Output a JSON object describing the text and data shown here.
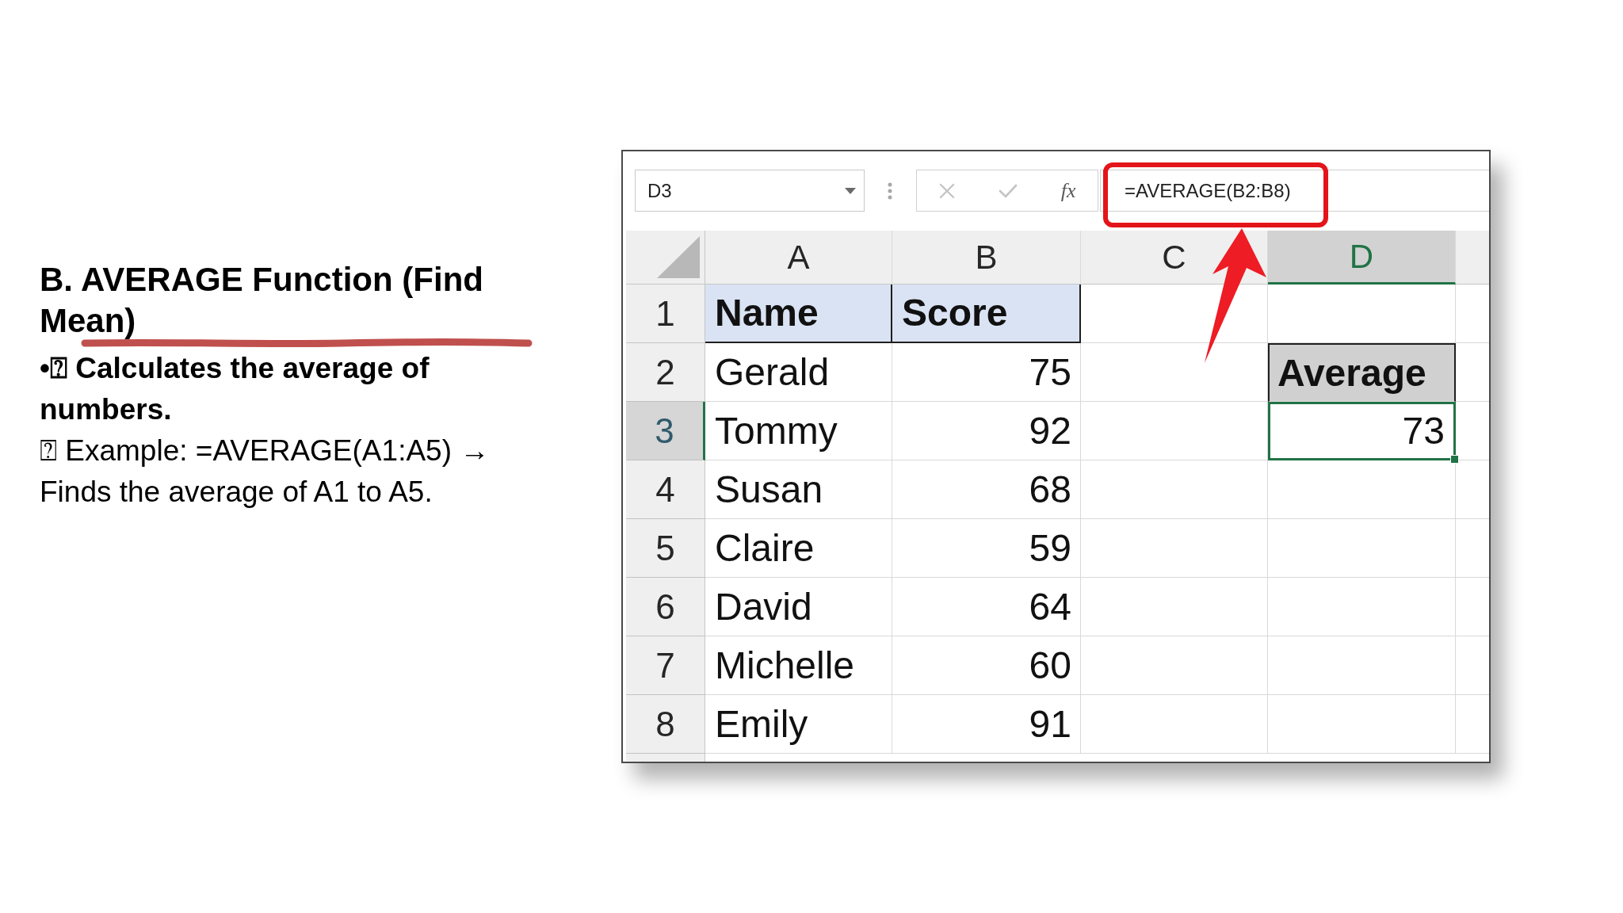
{
  "slide": {
    "title": {
      "text": "B. AVERAGE Function (Find Mean)",
      "underlined": true
    },
    "points": [
      {
        "kind": "bullet",
        "text": "•⍰ Calculates the average of numbers."
      },
      {
        "kind": "example",
        "text": "⍰ Example: =AVERAGE(A1:A5) → Finds the average of A1 to A5."
      }
    ]
  },
  "spreadsheet": {
    "name_box": {
      "value": "D3"
    },
    "formula_buttons": [
      {
        "kind": "cancel",
        "disabled": true
      },
      {
        "kind": "enter",
        "disabled": true
      },
      {
        "kind": "function",
        "label": "fx",
        "disabled": false
      }
    ],
    "formula": {
      "value": "=AVERAGE(B2:B8)",
      "highlighted": true
    },
    "columns": [
      {
        "label": "A",
        "selected": false
      },
      {
        "label": "B",
        "selected": false
      },
      {
        "label": "C",
        "selected": false
      },
      {
        "label": "D",
        "selected": true
      }
    ],
    "rows": [
      {
        "number": "1",
        "selected": false,
        "cells": [
          {
            "kind": "heading",
            "text": "Name",
            "selected": false
          },
          {
            "kind": "heading",
            "text": "Score",
            "selected": false
          },
          {
            "kind": "blank",
            "selected": false
          },
          {
            "kind": "blank",
            "selected": false
          }
        ]
      },
      {
        "number": "2",
        "selected": false,
        "cells": [
          {
            "kind": "text",
            "text": "Gerald",
            "selected": false
          },
          {
            "kind": "number",
            "text": "75",
            "selected": false
          },
          {
            "kind": "blank",
            "selected": false
          },
          {
            "kind": "label",
            "text": "Average",
            "selected": false
          }
        ]
      },
      {
        "number": "3",
        "selected": true,
        "cells": [
          {
            "kind": "text",
            "text": "Tommy",
            "selected": false
          },
          {
            "kind": "number",
            "text": "92",
            "selected": false
          },
          {
            "kind": "blank",
            "selected": false
          },
          {
            "kind": "number",
            "text": "73",
            "selected": true
          }
        ]
      },
      {
        "number": "4",
        "selected": false,
        "cells": [
          {
            "kind": "text",
            "text": "Susan",
            "selected": false
          },
          {
            "kind": "number",
            "text": "68",
            "selected": false
          },
          {
            "kind": "blank",
            "selected": false
          },
          {
            "kind": "blank",
            "selected": false
          }
        ]
      },
      {
        "number": "5",
        "selected": false,
        "cells": [
          {
            "kind": "text",
            "text": "Claire",
            "selected": false
          },
          {
            "kind": "number",
            "text": "59",
            "selected": false
          },
          {
            "kind": "blank",
            "selected": false
          },
          {
            "kind": "blank",
            "selected": false
          }
        ]
      },
      {
        "number": "6",
        "selected": false,
        "cells": [
          {
            "kind": "text",
            "text": "David",
            "selected": false
          },
          {
            "kind": "number",
            "text": "64",
            "selected": false
          },
          {
            "kind": "blank",
            "selected": false
          },
          {
            "kind": "blank",
            "selected": false
          }
        ]
      },
      {
        "number": "7",
        "selected": false,
        "cells": [
          {
            "kind": "text",
            "text": "Michelle",
            "selected": false
          },
          {
            "kind": "number",
            "text": "60",
            "selected": false
          },
          {
            "kind": "blank",
            "selected": false
          },
          {
            "kind": "blank",
            "selected": false
          }
        ]
      },
      {
        "number": "8",
        "selected": false,
        "cells": [
          {
            "kind": "text",
            "text": "Emily",
            "selected": false
          },
          {
            "kind": "number",
            "text": "91",
            "selected": false
          },
          {
            "kind": "blank",
            "selected": false
          },
          {
            "kind": "blank",
            "selected": false
          }
        ]
      }
    ]
  }
}
